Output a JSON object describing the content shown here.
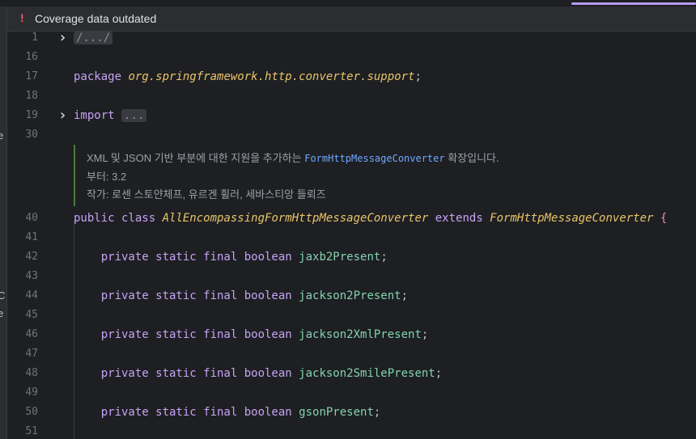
{
  "banner": {
    "icon": "exclamation-icon",
    "text": "Coverage data outdated"
  },
  "left_edge_chars": [
    "e",
    "C",
    "e"
  ],
  "lines": [
    {
      "num": "1",
      "fold": true,
      "tokens": [
        {
          "t": "/.../",
          "c": "folded"
        }
      ]
    },
    {
      "num": "16",
      "fold": false,
      "tokens": []
    },
    {
      "num": "17",
      "fold": false,
      "tokens": [
        {
          "t": "package ",
          "c": "kwp"
        },
        {
          "t": "org.springframework.http.converter.support",
          "c": "pkg"
        },
        {
          "t": ";",
          "c": "punct"
        }
      ]
    },
    {
      "num": "18",
      "fold": false,
      "tokens": []
    },
    {
      "num": "19",
      "fold": true,
      "tokens": [
        {
          "t": "import ",
          "c": "kwp"
        },
        {
          "t": "...",
          "c": "folded"
        }
      ]
    },
    {
      "num": "30",
      "fold": false,
      "tokens": []
    },
    {
      "num": "40",
      "fold": false,
      "tokens": [
        {
          "t": "public class ",
          "c": "kwp"
        },
        {
          "t": "AllEncompassingFormHttpMessageConverter",
          "c": "cls"
        },
        {
          "t": " extends ",
          "c": "kwp"
        },
        {
          "t": "FormHttpMessageConverter",
          "c": "cls"
        },
        {
          "t": " {",
          "c": "brace"
        }
      ]
    },
    {
      "num": "41",
      "fold": false,
      "tokens": []
    },
    {
      "num": "42",
      "fold": false,
      "tokens": [
        {
          "t": "    private static final boolean ",
          "c": "kwp"
        },
        {
          "t": "jaxb2Present",
          "c": "fld"
        },
        {
          "t": ";",
          "c": "punct"
        }
      ]
    },
    {
      "num": "43",
      "fold": false,
      "tokens": []
    },
    {
      "num": "44",
      "fold": false,
      "tokens": [
        {
          "t": "    private static final boolean ",
          "c": "kwp"
        },
        {
          "t": "jackson2Present",
          "c": "fld"
        },
        {
          "t": ";",
          "c": "punct"
        }
      ]
    },
    {
      "num": "45",
      "fold": false,
      "tokens": []
    },
    {
      "num": "46",
      "fold": false,
      "tokens": [
        {
          "t": "    private static final boolean ",
          "c": "kwp"
        },
        {
          "t": "jackson2XmlPresent",
          "c": "fld"
        },
        {
          "t": ";",
          "c": "punct"
        }
      ]
    },
    {
      "num": "47",
      "fold": false,
      "tokens": []
    },
    {
      "num": "48",
      "fold": false,
      "tokens": [
        {
          "t": "    private static final boolean ",
          "c": "kwp"
        },
        {
          "t": "jackson2SmilePresent",
          "c": "fld"
        },
        {
          "t": ";",
          "c": "punct"
        }
      ]
    },
    {
      "num": "49",
      "fold": false,
      "tokens": []
    },
    {
      "num": "50",
      "fold": false,
      "tokens": [
        {
          "t": "    private static final boolean ",
          "c": "kwp"
        },
        {
          "t": "gsonPresent",
          "c": "fld"
        },
        {
          "t": ";",
          "c": "punct"
        }
      ]
    },
    {
      "num": "51",
      "fold": false,
      "tokens": []
    }
  ],
  "doc": {
    "line1_pre": "XML 및 JSON 기반 부분에 대한 지원을 추가하는 ",
    "line1_link": "FormHttpMessageConverter",
    "line1_post": " 확장입니다.",
    "line2": "부터: 3.2",
    "line3": "작가: 로센 스토얀체프, 유르겐 휠러, 세바스티앙 들뢰즈"
  }
}
